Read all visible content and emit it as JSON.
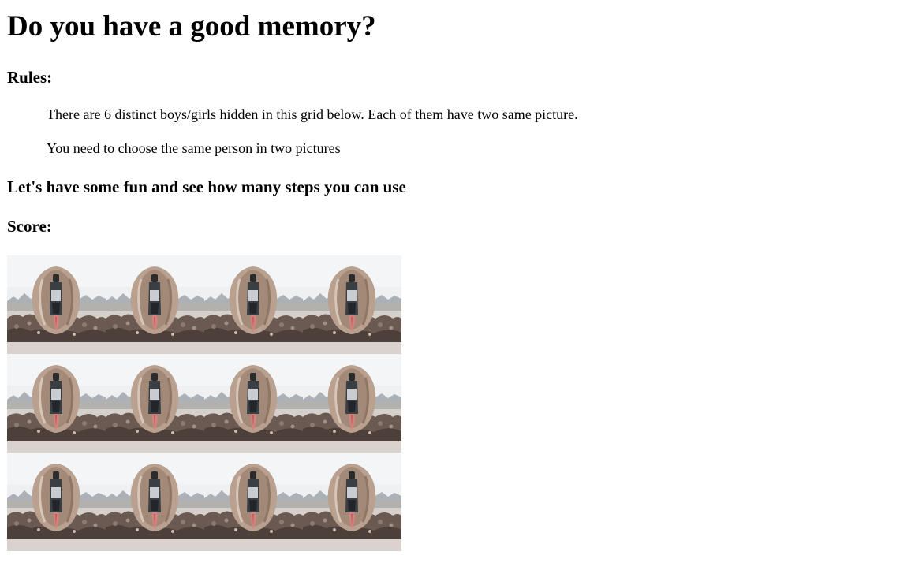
{
  "title": "Do you have a good memory?",
  "rules": {
    "heading": "Rules:",
    "items": [
      "There are 6 distinct boys/girls hidden in this grid below. Each of them have two same picture.",
      "You need to choose the same person in two pictures"
    ]
  },
  "fun_heading": "Let's have some fun and see how many steps you can use",
  "score": {
    "label": "Score:",
    "value": ""
  },
  "grid": {
    "rows": 3,
    "columns": 4,
    "card_back_image": "card-back-photo",
    "cards": [
      {
        "state": "face-down"
      },
      {
        "state": "face-down"
      },
      {
        "state": "face-down"
      },
      {
        "state": "face-down"
      },
      {
        "state": "face-down"
      },
      {
        "state": "face-down"
      },
      {
        "state": "face-down"
      },
      {
        "state": "face-down"
      },
      {
        "state": "face-down"
      },
      {
        "state": "face-down"
      },
      {
        "state": "face-down"
      },
      {
        "state": "face-down"
      }
    ]
  }
}
